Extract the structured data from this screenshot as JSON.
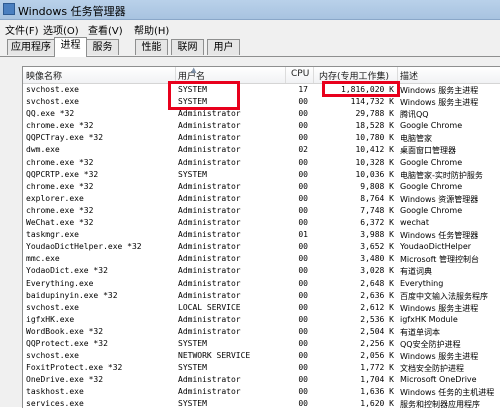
{
  "window": {
    "title": "Windows 任务管理器"
  },
  "menu": [
    "文件(F)",
    "选项(O)",
    "查看(V)",
    "帮助(H)"
  ],
  "tabs": [
    "应用程序",
    "进程",
    "服务",
    "性能",
    "联网",
    "用户"
  ],
  "active_tab": "进程",
  "columns": {
    "name": "映像名称",
    "user": "用户名",
    "cpu": "CPU",
    "memory": "内存(专用工作集)",
    "desc": "描述"
  },
  "processes": [
    {
      "name": "svchost.exe",
      "user": "SYSTEM",
      "cpu": "17",
      "memory": "1,816,020 K",
      "desc": "Windows 服务主进程"
    },
    {
      "name": "svchost.exe",
      "user": "SYSTEM",
      "cpu": "00",
      "memory": "114,732 K",
      "desc": "Windows 服务主进程"
    },
    {
      "name": "QQ.exe *32",
      "user": "Administrator",
      "cpu": "00",
      "memory": "29,788 K",
      "desc": "腾讯QQ"
    },
    {
      "name": "chrome.exe *32",
      "user": "Administrator",
      "cpu": "00",
      "memory": "18,528 K",
      "desc": "Google Chrome"
    },
    {
      "name": "QQPCTray.exe *32",
      "user": "Administrator",
      "cpu": "00",
      "memory": "10,780 K",
      "desc": "电脑管家"
    },
    {
      "name": "dwm.exe",
      "user": "Administrator",
      "cpu": "02",
      "memory": "10,412 K",
      "desc": "桌面窗口管理器"
    },
    {
      "name": "chrome.exe *32",
      "user": "Administrator",
      "cpu": "00",
      "memory": "10,328 K",
      "desc": "Google Chrome"
    },
    {
      "name": "QQPCRTP.exe *32",
      "user": "SYSTEM",
      "cpu": "00",
      "memory": "10,036 K",
      "desc": "电脑管家-实时防护服务"
    },
    {
      "name": "chrome.exe *32",
      "user": "Administrator",
      "cpu": "00",
      "memory": "9,808 K",
      "desc": "Google Chrome"
    },
    {
      "name": "explorer.exe",
      "user": "Administrator",
      "cpu": "00",
      "memory": "8,764 K",
      "desc": "Windows 资源管理器"
    },
    {
      "name": "chrome.exe *32",
      "user": "Administrator",
      "cpu": "00",
      "memory": "7,748 K",
      "desc": "Google Chrome"
    },
    {
      "name": "WeChat.exe *32",
      "user": "Administrator",
      "cpu": "00",
      "memory": "6,372 K",
      "desc": "wechat"
    },
    {
      "name": "taskmgr.exe",
      "user": "Administrator",
      "cpu": "01",
      "memory": "3,988 K",
      "desc": "Windows 任务管理器"
    },
    {
      "name": "YoudaoDictHelper.exe *32",
      "user": "Administrator",
      "cpu": "00",
      "memory": "3,652 K",
      "desc": "YoudaoDictHelper"
    },
    {
      "name": "mmc.exe",
      "user": "Administrator",
      "cpu": "00",
      "memory": "3,480 K",
      "desc": "Microsoft 管理控制台"
    },
    {
      "name": "YodaoDict.exe *32",
      "user": "Administrator",
      "cpu": "00",
      "memory": "3,028 K",
      "desc": "有道词典"
    },
    {
      "name": "Everything.exe",
      "user": "Administrator",
      "cpu": "00",
      "memory": "2,648 K",
      "desc": "Everything"
    },
    {
      "name": "baidupinyin.exe *32",
      "user": "Administrator",
      "cpu": "00",
      "memory": "2,636 K",
      "desc": "百度中文输入法服务程序"
    },
    {
      "name": "svchost.exe",
      "user": "LOCAL SERVICE",
      "cpu": "00",
      "memory": "2,612 K",
      "desc": "Windows 服务主进程"
    },
    {
      "name": "igfxHK.exe",
      "user": "Administrator",
      "cpu": "00",
      "memory": "2,536 K",
      "desc": "igfxHK Module"
    },
    {
      "name": "WordBook.exe *32",
      "user": "Administrator",
      "cpu": "00",
      "memory": "2,504 K",
      "desc": "有道单词本"
    },
    {
      "name": "QQProtect.exe *32",
      "user": "SYSTEM",
      "cpu": "00",
      "memory": "2,256 K",
      "desc": "QQ安全防护进程"
    },
    {
      "name": "svchost.exe",
      "user": "NETWORK SERVICE",
      "cpu": "00",
      "memory": "2,056 K",
      "desc": "Windows 服务主进程"
    },
    {
      "name": "FoxitProtect.exe *32",
      "user": "SYSTEM",
      "cpu": "00",
      "memory": "1,772 K",
      "desc": "文档安全防护进程"
    },
    {
      "name": "OneDrive.exe *32",
      "user": "Administrator",
      "cpu": "00",
      "memory": "1,704 K",
      "desc": "Microsoft OneDrive"
    },
    {
      "name": "taskhost.exe",
      "user": "Administrator",
      "cpu": "00",
      "memory": "1,636 K",
      "desc": "Windows 任务的主机进程"
    },
    {
      "name": "services.exe",
      "user": "SYSTEM",
      "cpu": "00",
      "memory": "1,620 K",
      "desc": "服务和控制器应用程序"
    }
  ],
  "highlight_color": "#e8001c"
}
